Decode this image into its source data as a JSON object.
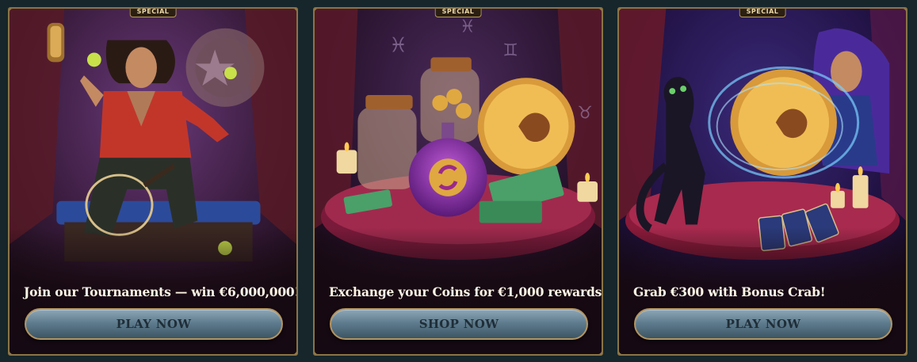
{
  "cards": [
    {
      "badge": "SPECIAL",
      "title": "Join our Tournaments — win €6,000,000!",
      "button_label": "PLAY NOW",
      "art_icon": "tennis-player-illustration"
    },
    {
      "badge": "SPECIAL",
      "title": "Exchange your Coins for €1,000 rewards!",
      "button_label": "SHOP NOW",
      "art_icon": "coin-jars-illustration"
    },
    {
      "badge": "SPECIAL",
      "title": "Grab €300 with Bonus Crab!",
      "button_label": "PLAY NOW",
      "art_icon": "fortune-teller-cat-illustration"
    }
  ],
  "colors": {
    "page_bg": "#16262a",
    "frame_gold": "#8a7446",
    "button_top": "#8ea6b5",
    "button_bottom": "#3c5564"
  }
}
